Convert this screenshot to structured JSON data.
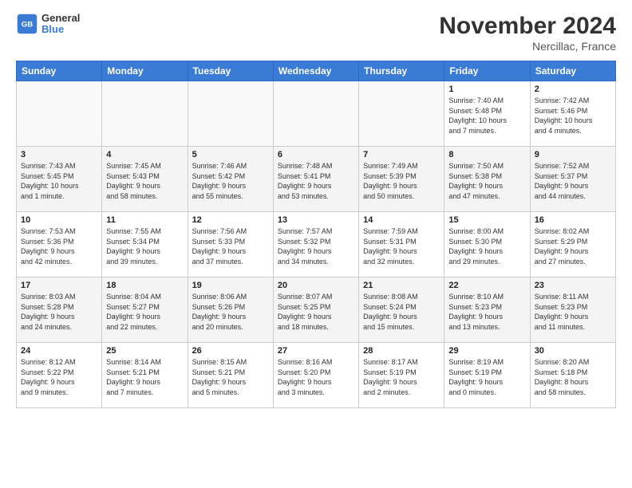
{
  "header": {
    "logo_line1": "General",
    "logo_line2": "Blue",
    "month": "November 2024",
    "location": "Nercillac, France"
  },
  "days_of_week": [
    "Sunday",
    "Monday",
    "Tuesday",
    "Wednesday",
    "Thursday",
    "Friday",
    "Saturday"
  ],
  "weeks": [
    [
      {
        "day": "",
        "info": ""
      },
      {
        "day": "",
        "info": ""
      },
      {
        "day": "",
        "info": ""
      },
      {
        "day": "",
        "info": ""
      },
      {
        "day": "",
        "info": ""
      },
      {
        "day": "1",
        "info": "Sunrise: 7:40 AM\nSunset: 5:48 PM\nDaylight: 10 hours\nand 7 minutes."
      },
      {
        "day": "2",
        "info": "Sunrise: 7:42 AM\nSunset: 5:46 PM\nDaylight: 10 hours\nand 4 minutes."
      }
    ],
    [
      {
        "day": "3",
        "info": "Sunrise: 7:43 AM\nSunset: 5:45 PM\nDaylight: 10 hours\nand 1 minute."
      },
      {
        "day": "4",
        "info": "Sunrise: 7:45 AM\nSunset: 5:43 PM\nDaylight: 9 hours\nand 58 minutes."
      },
      {
        "day": "5",
        "info": "Sunrise: 7:46 AM\nSunset: 5:42 PM\nDaylight: 9 hours\nand 55 minutes."
      },
      {
        "day": "6",
        "info": "Sunrise: 7:48 AM\nSunset: 5:41 PM\nDaylight: 9 hours\nand 53 minutes."
      },
      {
        "day": "7",
        "info": "Sunrise: 7:49 AM\nSunset: 5:39 PM\nDaylight: 9 hours\nand 50 minutes."
      },
      {
        "day": "8",
        "info": "Sunrise: 7:50 AM\nSunset: 5:38 PM\nDaylight: 9 hours\nand 47 minutes."
      },
      {
        "day": "9",
        "info": "Sunrise: 7:52 AM\nSunset: 5:37 PM\nDaylight: 9 hours\nand 44 minutes."
      }
    ],
    [
      {
        "day": "10",
        "info": "Sunrise: 7:53 AM\nSunset: 5:36 PM\nDaylight: 9 hours\nand 42 minutes."
      },
      {
        "day": "11",
        "info": "Sunrise: 7:55 AM\nSunset: 5:34 PM\nDaylight: 9 hours\nand 39 minutes."
      },
      {
        "day": "12",
        "info": "Sunrise: 7:56 AM\nSunset: 5:33 PM\nDaylight: 9 hours\nand 37 minutes."
      },
      {
        "day": "13",
        "info": "Sunrise: 7:57 AM\nSunset: 5:32 PM\nDaylight: 9 hours\nand 34 minutes."
      },
      {
        "day": "14",
        "info": "Sunrise: 7:59 AM\nSunset: 5:31 PM\nDaylight: 9 hours\nand 32 minutes."
      },
      {
        "day": "15",
        "info": "Sunrise: 8:00 AM\nSunset: 5:30 PM\nDaylight: 9 hours\nand 29 minutes."
      },
      {
        "day": "16",
        "info": "Sunrise: 8:02 AM\nSunset: 5:29 PM\nDaylight: 9 hours\nand 27 minutes."
      }
    ],
    [
      {
        "day": "17",
        "info": "Sunrise: 8:03 AM\nSunset: 5:28 PM\nDaylight: 9 hours\nand 24 minutes."
      },
      {
        "day": "18",
        "info": "Sunrise: 8:04 AM\nSunset: 5:27 PM\nDaylight: 9 hours\nand 22 minutes."
      },
      {
        "day": "19",
        "info": "Sunrise: 8:06 AM\nSunset: 5:26 PM\nDaylight: 9 hours\nand 20 minutes."
      },
      {
        "day": "20",
        "info": "Sunrise: 8:07 AM\nSunset: 5:25 PM\nDaylight: 9 hours\nand 18 minutes."
      },
      {
        "day": "21",
        "info": "Sunrise: 8:08 AM\nSunset: 5:24 PM\nDaylight: 9 hours\nand 15 minutes."
      },
      {
        "day": "22",
        "info": "Sunrise: 8:10 AM\nSunset: 5:23 PM\nDaylight: 9 hours\nand 13 minutes."
      },
      {
        "day": "23",
        "info": "Sunrise: 8:11 AM\nSunset: 5:23 PM\nDaylight: 9 hours\nand 11 minutes."
      }
    ],
    [
      {
        "day": "24",
        "info": "Sunrise: 8:12 AM\nSunset: 5:22 PM\nDaylight: 9 hours\nand 9 minutes."
      },
      {
        "day": "25",
        "info": "Sunrise: 8:14 AM\nSunset: 5:21 PM\nDaylight: 9 hours\nand 7 minutes."
      },
      {
        "day": "26",
        "info": "Sunrise: 8:15 AM\nSunset: 5:21 PM\nDaylight: 9 hours\nand 5 minutes."
      },
      {
        "day": "27",
        "info": "Sunrise: 8:16 AM\nSunset: 5:20 PM\nDaylight: 9 hours\nand 3 minutes."
      },
      {
        "day": "28",
        "info": "Sunrise: 8:17 AM\nSunset: 5:19 PM\nDaylight: 9 hours\nand 2 minutes."
      },
      {
        "day": "29",
        "info": "Sunrise: 8:19 AM\nSunset: 5:19 PM\nDaylight: 9 hours\nand 0 minutes."
      },
      {
        "day": "30",
        "info": "Sunrise: 8:20 AM\nSunset: 5:18 PM\nDaylight: 8 hours\nand 58 minutes."
      }
    ]
  ]
}
